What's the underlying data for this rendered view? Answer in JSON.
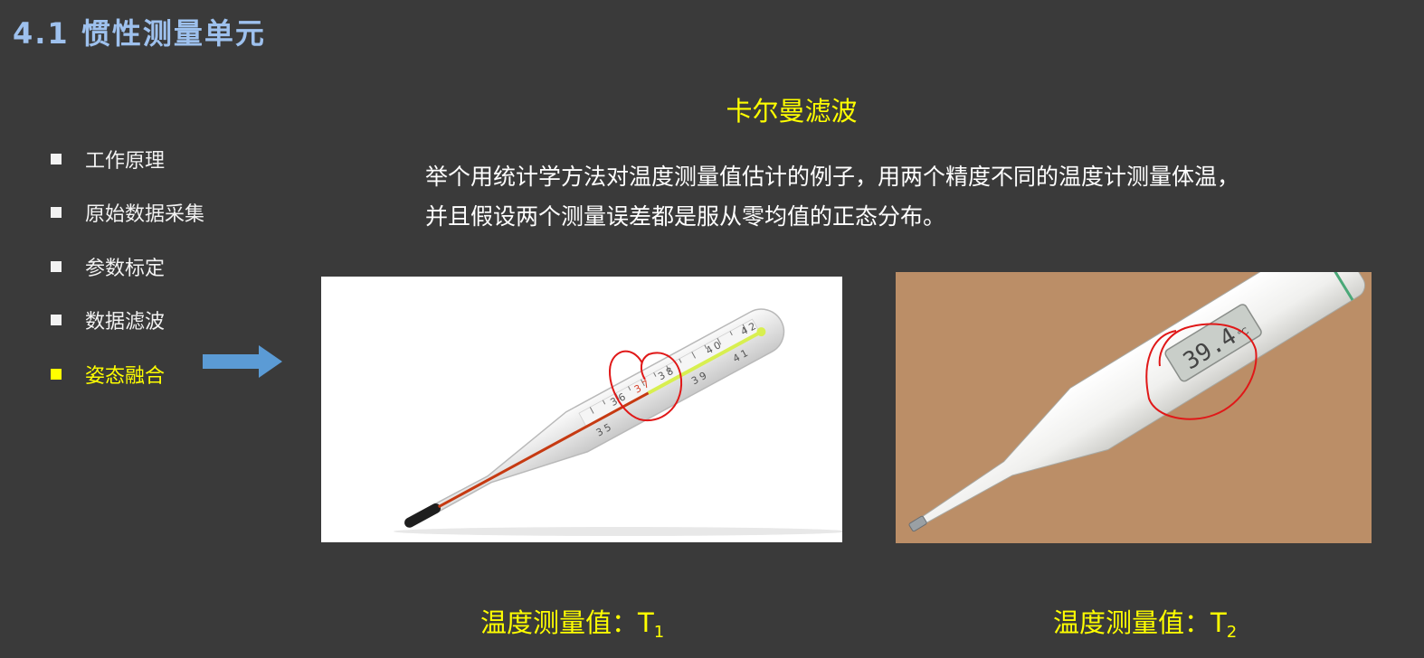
{
  "slide": {
    "title": "4.1 惯性测量单元",
    "heading": "卡尔曼滤波",
    "paragraph": "举个用统计学方法对温度测量值估计的例子，用两个精度不同的温度计测量体温，并且假设两个测量误差都是服从零均值的正态分布。"
  },
  "menu": {
    "items": [
      {
        "label": "工作原理",
        "active": false
      },
      {
        "label": "原始数据采集",
        "active": false
      },
      {
        "label": "参数标定",
        "active": false
      },
      {
        "label": "数据滤波",
        "active": false
      },
      {
        "label": "姿态融合",
        "active": true
      }
    ]
  },
  "images": {
    "mercury": {
      "marks": [
        "3",
        "5",
        "3",
        "6",
        "3",
        "7",
        "3",
        "8",
        "3",
        "9",
        "4",
        "0",
        "4",
        "1",
        "4",
        "2"
      ]
    },
    "digital": {
      "display": "39.4",
      "unit": "°C"
    }
  },
  "captions": {
    "t1": {
      "text": "温度测量值：T",
      "sub": "1"
    },
    "t2": {
      "text": "温度测量值：T",
      "sub": "2"
    }
  },
  "colors": {
    "title": "#9ec1ee",
    "accent": "#ffff00",
    "arrow": "#5b9bd5",
    "background": "#3a3a3a",
    "circle": "#e01818"
  }
}
